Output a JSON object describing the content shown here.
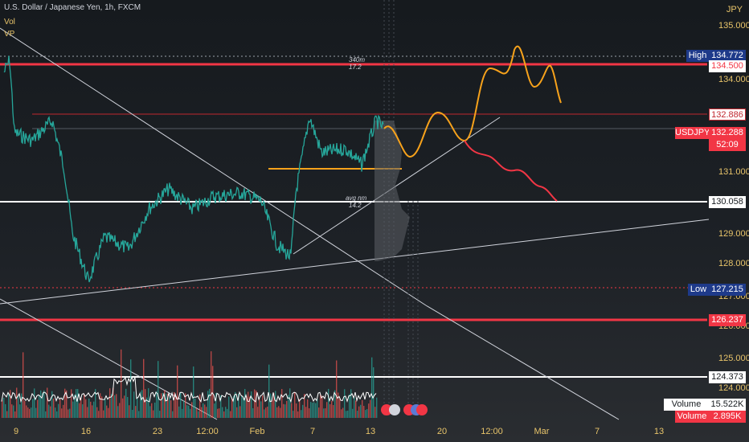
{
  "header": {
    "symbol_title": "U.S. Dollar / Japanese Yen, 1h, FXCM",
    "indicator_vol": "Vol",
    "indicator_vp": "VP",
    "currency": "JPY"
  },
  "price_axis": {
    "ticks": [
      "135.000",
      "134.000",
      "131.000",
      "129.000",
      "128.000",
      "127.000",
      "126.000",
      "125.000",
      "124.000"
    ]
  },
  "time_axis": {
    "ticks": [
      "9",
      "16",
      "23",
      "12:00",
      "Feb",
      "7",
      "13",
      "20",
      "12:00",
      "Mar",
      "7",
      "13"
    ]
  },
  "levels": {
    "high": {
      "label": "High",
      "value": "134.772"
    },
    "red_top": "134.500",
    "resistance": "132.886",
    "symbol": {
      "label": "USDJPY",
      "value": "132.288",
      "countdown": "52:09"
    },
    "support": "130.058",
    "low": {
      "label": "Low",
      "value": "127.215"
    },
    "red_bottom": "126.237",
    "white_bottom": "124.373"
  },
  "volume": {
    "ma_label": "Volume MA",
    "ma_value": "15.522K",
    "vol_label": "Volume",
    "vol_value": "2.895K"
  },
  "annotations": {
    "range_top": "340m",
    "range_top_sub": "17.2",
    "range_mid": "avg nm",
    "range_mid_sub": "14.2"
  },
  "colors": {
    "bull": "#26a69a",
    "bear": "#ef5350",
    "level_red": "#f23645",
    "projection_orange": "#f7a21b",
    "projection_red": "#f23645",
    "axis_text": "#e8c46a"
  }
}
